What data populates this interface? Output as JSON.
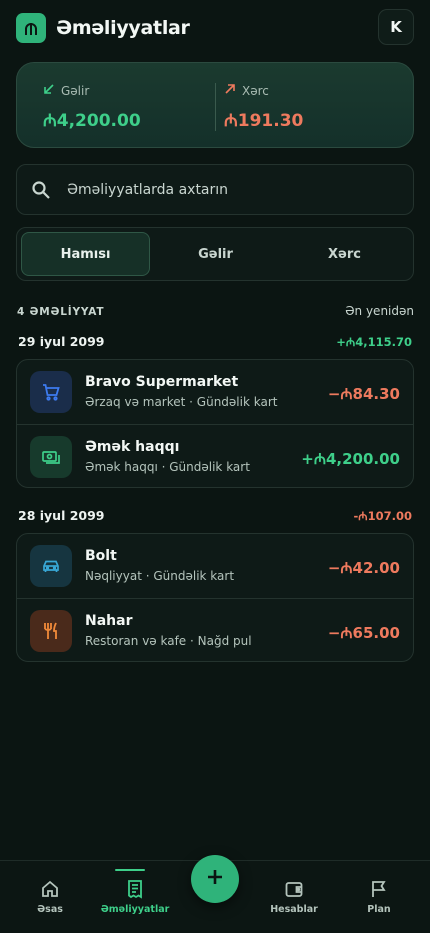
{
  "app": {
    "title": "Əməliyyatlar",
    "avatar_initial": "K"
  },
  "summary": {
    "income": {
      "label": "Gəlir",
      "value": "₼4,200.00"
    },
    "expense": {
      "label": "Xərc",
      "value": "₼191.30"
    }
  },
  "search": {
    "placeholder": "Əməliyyatlarda axtarın",
    "value": ""
  },
  "filters": [
    {
      "label": "Hamısı",
      "active": true
    },
    {
      "label": "Gəlir",
      "active": false
    },
    {
      "label": "Xərc",
      "active": false
    }
  ],
  "list_meta": {
    "count": "4 ƏMƏLİYYAT",
    "sort": "Ən yenidən"
  },
  "days": [
    {
      "date": "29 iyul 2099",
      "total": "+₼4,115.70",
      "items": [
        {
          "title": "Bravo Supermarket",
          "subtitle": "Ərzaq və market · Gündəlik kart",
          "amount": "−₼84.30",
          "icon": "cart-icon"
        },
        {
          "title": "Əmək haqqı",
          "subtitle": "Əmək haqqı · Gündəlik kart",
          "amount": "+₼4,200.00",
          "icon": "money-icon"
        }
      ]
    },
    {
      "date": "28 iyul 2099",
      "total": "-₼107.00",
      "items": [
        {
          "title": "Bolt",
          "subtitle": "Nəqliyyat · Gündəlik kart",
          "amount": "−₼42.00",
          "icon": "car-icon"
        },
        {
          "title": "Nahar",
          "subtitle": "Restoran və kafe · Nağd pul",
          "amount": "−₼65.00",
          "icon": "utensils-icon"
        }
      ]
    }
  ],
  "nav": {
    "items": [
      {
        "label": "Əsas",
        "icon": "home-icon",
        "active": false
      },
      {
        "label": "Əməliyyatlar",
        "icon": "receipt-icon",
        "active": true
      },
      {
        "label": "Hesablar",
        "icon": "wallet-icon",
        "active": false
      },
      {
        "label": "Plan",
        "icon": "flag-icon",
        "active": false
      }
    ],
    "fab_icon": "plus-icon"
  },
  "colors": {
    "accent": "#2fb37a",
    "income": "#3ecf8a",
    "expense": "#ee7a5e",
    "background": "#0b1512"
  }
}
